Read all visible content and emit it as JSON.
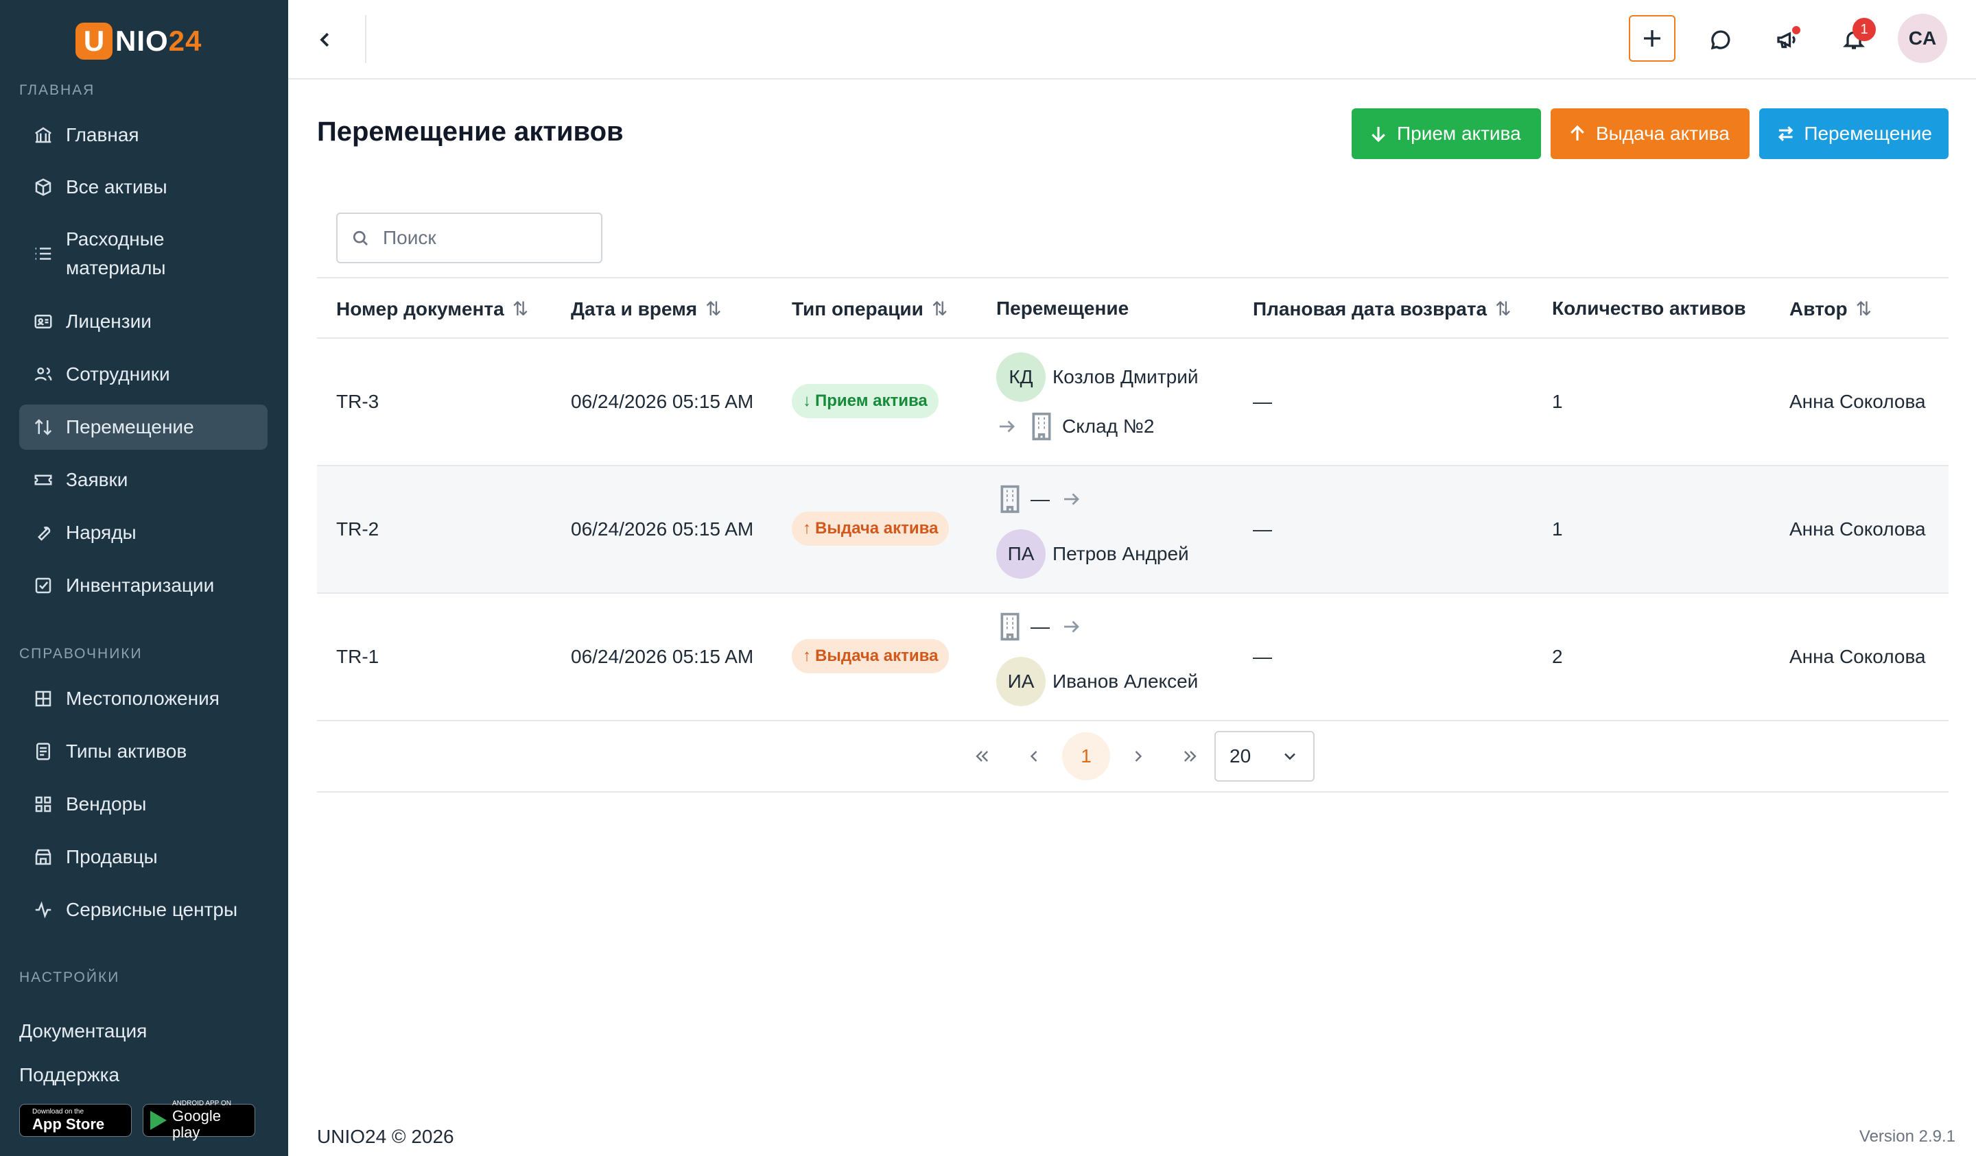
{
  "brand": {
    "logo_letter": "U",
    "logo_text": "NIO",
    "logo_num": "24"
  },
  "sidebar": {
    "section_main": "ГЛАВНАЯ",
    "main_items": [
      {
        "label": "Главная",
        "icon": "bank-icon"
      },
      {
        "label": "Все активы",
        "icon": "box-icon"
      },
      {
        "label": "Расходные материалы",
        "icon": "list-icon"
      },
      {
        "label": "Лицензии",
        "icon": "id-card-icon"
      },
      {
        "label": "Сотрудники",
        "icon": "users-icon"
      },
      {
        "label": "Перемещение",
        "icon": "arrows-updown-icon",
        "active": true
      },
      {
        "label": "Заявки",
        "icon": "ticket-icon"
      },
      {
        "label": "Наряды",
        "icon": "wrench-icon"
      },
      {
        "label": "Инвентаризации",
        "icon": "checkbox-icon"
      }
    ],
    "section_refs": "СПРАВОЧНИКИ",
    "ref_items": [
      {
        "label": "Местоположения",
        "icon": "grid-icon"
      },
      {
        "label": "Типы активов",
        "icon": "document-icon"
      },
      {
        "label": "Вендоры",
        "icon": "apps-icon"
      },
      {
        "label": "Продавцы",
        "icon": "store-icon"
      },
      {
        "label": "Сервисные центры",
        "icon": "activity-icon"
      }
    ],
    "section_settings": "НАСТРОЙКИ",
    "docs_label": "Документация",
    "support_label": "Поддержка",
    "appstore": {
      "small": "Download on the",
      "big": "App Store"
    },
    "googleplay": {
      "small": "ANDROID APP ON",
      "big": "Google play"
    }
  },
  "header": {
    "notification_count": "1",
    "user_initials": "CA"
  },
  "page": {
    "title": "Перемещение активов",
    "btn_receive": "Прием актива",
    "btn_issue": "Выдача актива",
    "btn_move": "Перемещение"
  },
  "search": {
    "placeholder": "Поиск"
  },
  "table": {
    "columns": [
      "Номер документа",
      "Дата и время",
      "Тип операции",
      "Перемещение",
      "Плановая дата возврата",
      "Количество активов",
      "Автор"
    ],
    "rows": [
      {
        "doc": "TR-3",
        "datetime": "06/24/2026 05:15 AM",
        "operation": "Прием актива",
        "from_initials": "КД",
        "from_name": "Козлов Дмитрий",
        "to_name": "Склад №2",
        "return_date": "—",
        "count": "1",
        "author": "Анна Соколова"
      },
      {
        "doc": "TR-2",
        "datetime": "06/24/2026 05:15 AM",
        "operation": "Выдача актива",
        "from_name": "—",
        "to_initials": "ПА",
        "to_name": "Петров Андрей",
        "return_date": "—",
        "count": "1",
        "author": "Анна Соколова"
      },
      {
        "doc": "TR-1",
        "datetime": "06/24/2026 05:15 AM",
        "operation": "Выдача актива",
        "from_name": "—",
        "to_initials": "ИА",
        "to_name": "Иванов Алексей",
        "return_date": "—",
        "count": "2",
        "author": "Анна Соколова"
      }
    ]
  },
  "pagination": {
    "current_page": "1",
    "page_size": "20"
  },
  "footer": {
    "copyright": "UNIO24 © 2026",
    "version": "Version 2.9.1"
  },
  "colors": {
    "sidebar_bg": "#1d3443",
    "accent_orange": "#f07c1b",
    "green": "#22b14c",
    "blue": "#1a9de0"
  }
}
